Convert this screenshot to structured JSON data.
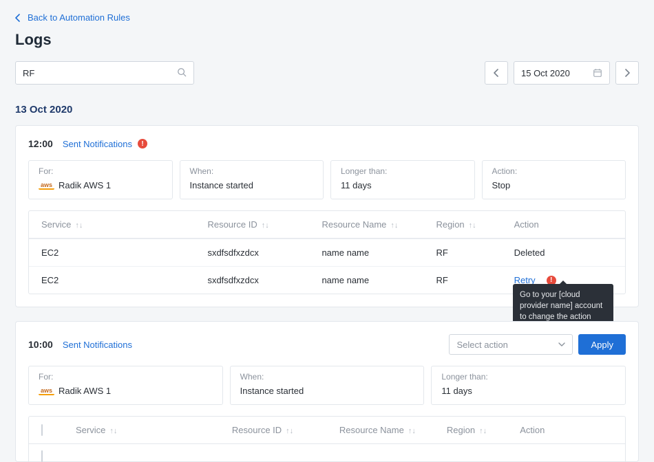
{
  "back_link": "Back to Automation Rules",
  "page_title": "Logs",
  "search_value": "RF",
  "date_picker": "15 Oct 2020",
  "group_date": "13 Oct 2020",
  "section1": {
    "time": "12:00",
    "sent_label": "Sent Notifications",
    "info": {
      "for_k": "For:",
      "for_v": "Radik AWS 1",
      "aws_badge": "aws",
      "when_k": "When:",
      "when_v": "Instance started",
      "longer_k": "Longer than:",
      "longer_v": "11 days",
      "action_k": "Action:",
      "action_v": "Stop"
    },
    "cols": {
      "service": "Service",
      "resource_id": "Resource ID",
      "resource_name": "Resource Name",
      "region": "Region",
      "action": "Action"
    },
    "rows": [
      {
        "service": "EC2",
        "resource_id": "sxdfsdfxzdcx",
        "resource_name": "name name",
        "region": "RF",
        "action": "Deleted"
      },
      {
        "service": "EC2",
        "resource_id": "sxdfsdfxzdcx",
        "resource_name": "name name",
        "region": "RF",
        "action": "Retry"
      }
    ],
    "tooltip": "Go to your [cloud provider name] account to change the action"
  },
  "section2": {
    "time": "10:00",
    "sent_label": "Sent Notifications",
    "select_placeholder": "Select action",
    "apply_label": "Apply",
    "info": {
      "for_k": "For:",
      "for_v": "Radik AWS 1",
      "aws_badge": "aws",
      "when_k": "When:",
      "when_v": "Instance started",
      "longer_k": "Longer than:",
      "longer_v": "11 days"
    },
    "cols": {
      "service": "Service",
      "resource_id": "Resource ID",
      "resource_name": "Resource Name",
      "region": "Region",
      "action": "Action"
    }
  }
}
